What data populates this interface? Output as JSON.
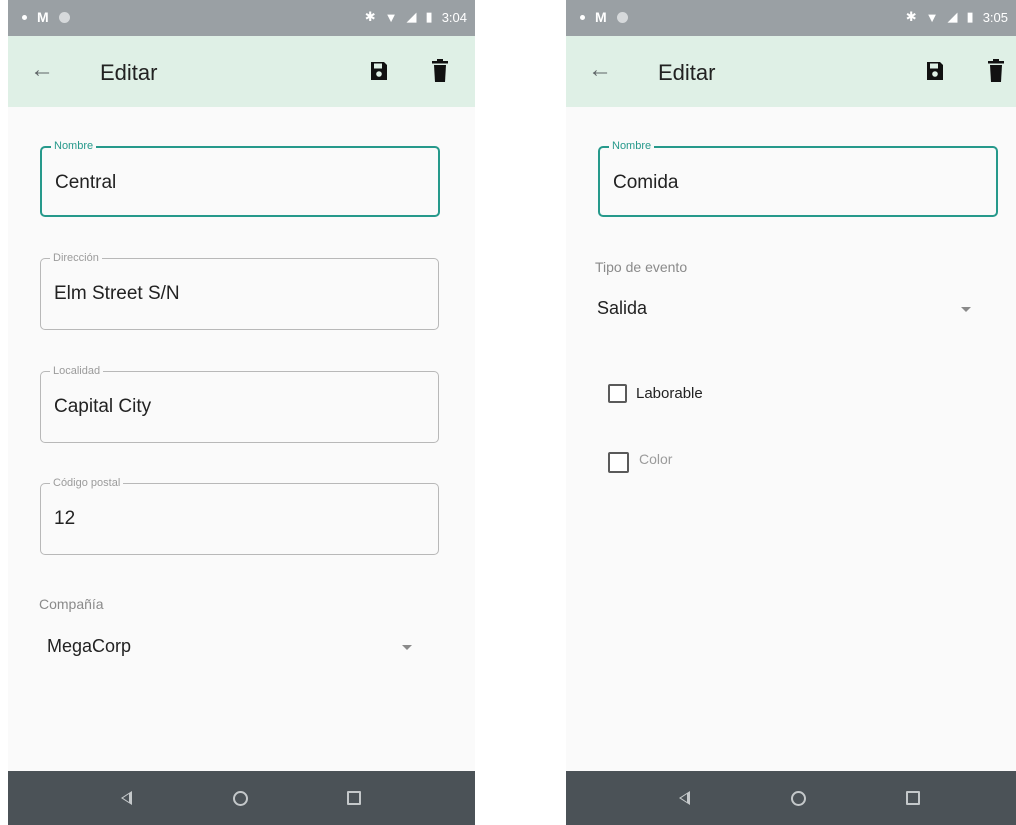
{
  "status_bar": {
    "time_left": "3:04",
    "time_right": "3:05"
  },
  "left_screen": {
    "title": "Editar",
    "icons": {
      "back": "arrow-back-icon",
      "save": "save-icon",
      "delete": "trash-icon"
    },
    "fields": {
      "nombre": {
        "label": "Nombre",
        "value": "Central"
      },
      "direccion": {
        "label": "Dirección",
        "value": "Elm Street S/N"
      },
      "localidad": {
        "label": "Localidad",
        "value": "Capital City"
      },
      "codigo_postal": {
        "label": "Código postal",
        "value": "12"
      }
    },
    "compania": {
      "label": "Compañía",
      "value": "MegaCorp"
    }
  },
  "right_screen": {
    "title": "Editar",
    "icons": {
      "back": "arrow-back-icon",
      "save": "save-icon",
      "delete": "trash-icon"
    },
    "nombre": {
      "label": "Nombre",
      "value": "Comida"
    },
    "tipo_evento": {
      "label": "Tipo de evento",
      "value": "Salida"
    },
    "laborable": {
      "label": "Laborable",
      "checked": false
    },
    "color": {
      "label": "Color",
      "checked": false
    }
  },
  "colors": {
    "appbar": "#dff0e6",
    "accent": "#26998b",
    "navbar": "#4b5257",
    "statusbar": "#9aa0a4"
  }
}
